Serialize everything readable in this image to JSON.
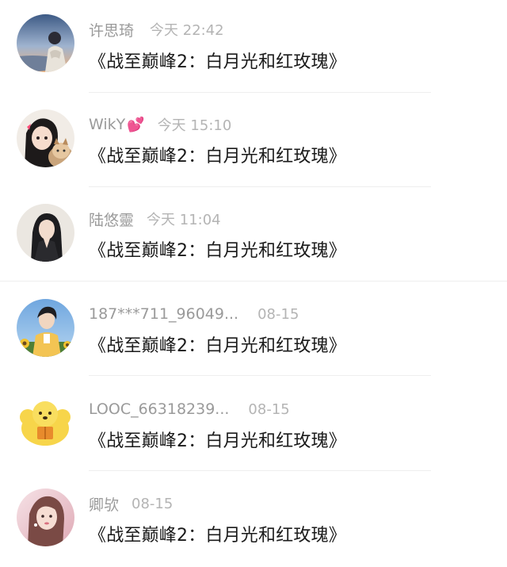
{
  "comments": [
    {
      "username": "许思琦",
      "time": "今天 22:42",
      "text": "《战至巅峰2：白月光和红玫瑰》",
      "avatar_icon": "girl-sunset-sky-avatar",
      "colors": {
        "bg_top": "#3d5a85",
        "bg_bottom": "#f0b27a"
      }
    },
    {
      "username": "WikY",
      "heart": "💕",
      "time": "今天 15:10",
      "text": "《战至巅峰2：白月光和红玫瑰》",
      "avatar_icon": "girl-with-cat-avatar",
      "colors": {
        "bg_top": "#f3eee8",
        "bg_bottom": "#d9c6b4"
      }
    },
    {
      "username": "陆悠靈",
      "time": "今天 11:04",
      "text": "《战至巅峰2：白月光和红玫瑰》",
      "avatar_icon": "woman-portrait-avatar",
      "colors": {
        "bg_top": "#ede9e4",
        "bg_bottom": "#bdb6ad"
      }
    },
    {
      "username": "187***711_96049...",
      "time": "08-15",
      "text": "《战至巅峰2：白月光和红玫瑰》",
      "avatar_icon": "boy-sky-sunflower-avatar",
      "colors": {
        "bg_top": "#7fb3e6",
        "bg_bottom": "#5d8f3f"
      }
    },
    {
      "username": "LOOC_66318239...",
      "time": "08-15",
      "text": "《战至巅峰2：白月光和红玫瑰》",
      "avatar_icon": "yellow-cartoon-dog-avatar",
      "colors": {
        "bg_top": "#ffffff",
        "bg_bottom": "#ffffff"
      }
    },
    {
      "username": "卿欤",
      "time": "08-15",
      "text": "《战至巅峰2：白月光和红玫瑰》",
      "avatar_icon": "woman-pink-portrait-avatar",
      "colors": {
        "bg_top": "#f4dadf",
        "bg_bottom": "#e3b4bf"
      }
    }
  ]
}
